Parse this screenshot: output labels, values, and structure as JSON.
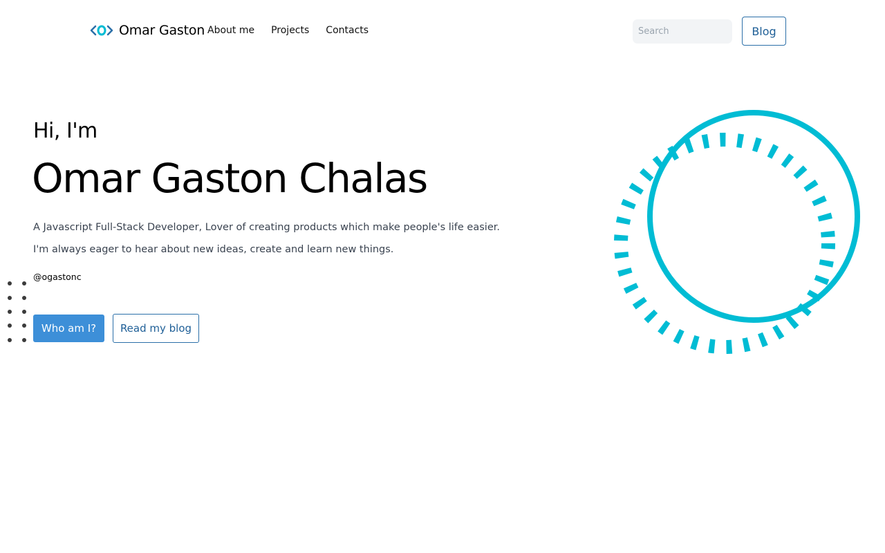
{
  "header": {
    "logo_text": "Omar Gaston",
    "nav": [
      {
        "label": "About me"
      },
      {
        "label": "Projects"
      },
      {
        "label": "Contacts"
      }
    ],
    "search_placeholder": "Search",
    "blog_label": "Blog"
  },
  "hero": {
    "greeting": "Hi, I'm",
    "name": "Omar Gaston Chalas",
    "description_line1": "A Javascript Full-Stack Developer, Lover of creating products which make people's life easier.",
    "description_line2": "I'm always eager to hear about new ideas, create and learn new things.",
    "handle": "@ogastonc",
    "primary_button": "Who am I?",
    "secondary_button": "Read my blog"
  },
  "colors": {
    "accent_cyan": "#00bcd4",
    "primary_blue": "#3d8fd8",
    "outline_blue": "#2b6fa8"
  },
  "icons": {
    "logo": "code-brackets-icon",
    "decoration": "dashed-rings-icon",
    "dots": "dot-grid-icon"
  }
}
